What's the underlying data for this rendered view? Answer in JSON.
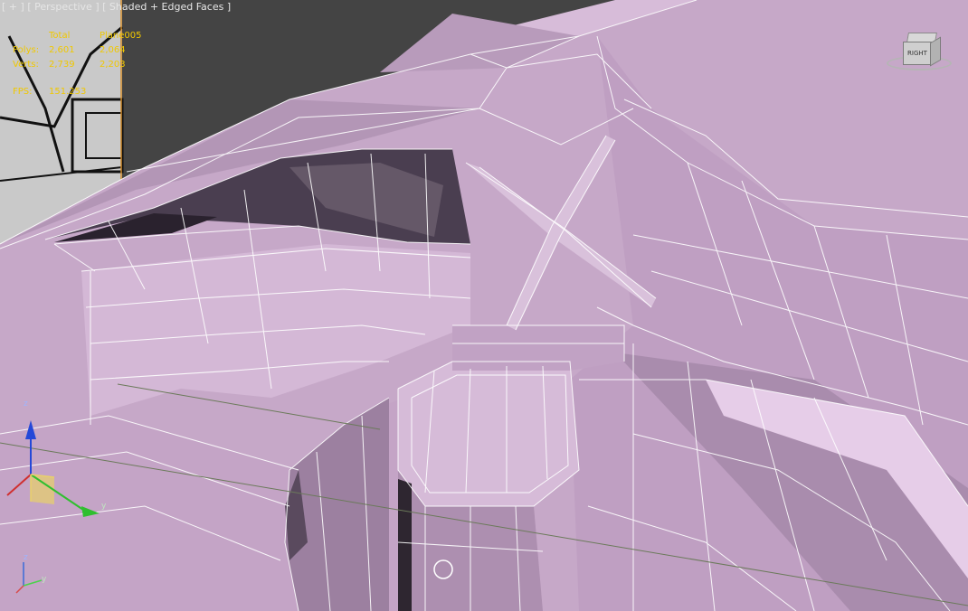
{
  "viewport": {
    "label_parts": [
      "+",
      "Perspective",
      "Shaded + Edged Faces"
    ]
  },
  "stats": {
    "header_total": "Total",
    "header_object": "Plane005",
    "polys_label": "Polys:",
    "polys_total": "2,601",
    "polys_object": "2,064",
    "verts_label": "Verts:",
    "verts_total": "2,739",
    "verts_object": "2,203",
    "fps_label": "FPS:",
    "fps_value": "151.253"
  },
  "viewcube": {
    "face_label": "RIGHT"
  },
  "gizmo": {
    "axis_x": "x",
    "axis_y": "y",
    "axis_z": "z"
  },
  "colors": {
    "mesh": "#c6a8c8",
    "mesh_light": "#e8cdea",
    "mesh_dark": "#8e7592",
    "edge": "#ffffff",
    "background": "#444444",
    "stats_text": "#f0c800"
  }
}
